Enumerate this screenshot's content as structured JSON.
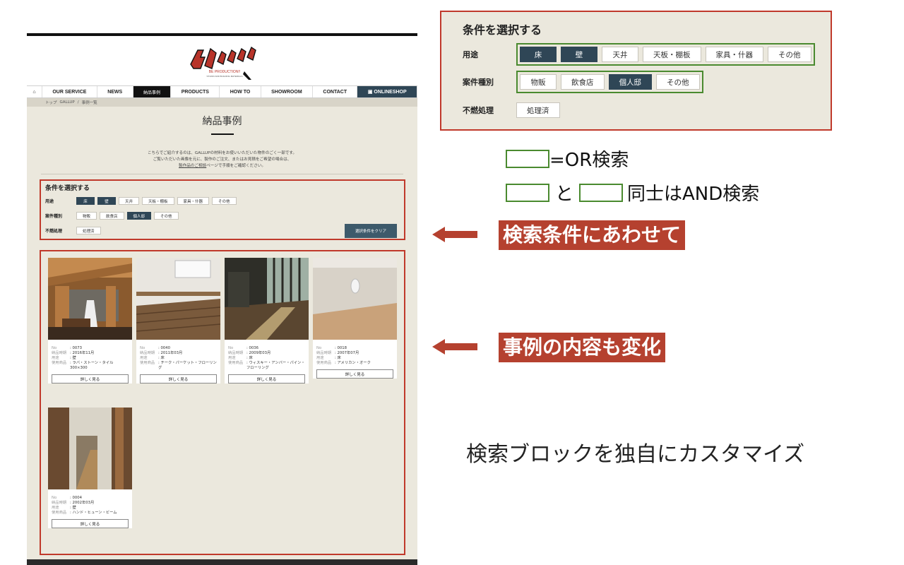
{
  "site": {
    "logo_text": "GALLUP",
    "logo_sub": "BE PRODUCTION!!",
    "logo_sub2": "STUDIO AND BUILDING MATERIALS",
    "nav": [
      "OUR SERVICE",
      "NEWS",
      "納品事例",
      "PRODUCTS",
      "HOW TO",
      "SHOWROOM",
      "CONTACT",
      "ONLINESHOP"
    ],
    "breadcrumb": [
      "トップ",
      "GALLUP",
      "/",
      "事例一覧"
    ],
    "page_title": "納品事例",
    "intro": [
      "こちらでご紹介するのは、GALLUPの材料をお使いいただいた物件のごく一部です。",
      "ご覧いただいた画像を元に、製作のご注文、またはお見積をご希望の場合は、",
      "ページで手順をご確認ください。"
    ],
    "intro_link": "製作品のご相談",
    "search": {
      "title": "条件を選択する",
      "rows": [
        {
          "label": "用途",
          "chips": [
            "床",
            "壁",
            "天井",
            "天板・棚板",
            "家具・什器",
            "その他"
          ],
          "selected": [
            0,
            1
          ]
        },
        {
          "label": "案件種別",
          "chips": [
            "物販",
            "飲食店",
            "個人邸",
            "その他"
          ],
          "selected": [
            2
          ]
        },
        {
          "label": "不燃処理",
          "chips": [
            "処理済"
          ],
          "selected": []
        }
      ],
      "clear_label": "選択条件をクリア"
    },
    "meta_keys": {
      "no": "No",
      "date": "納品時期",
      "use": "用途",
      "product": "使用商品"
    },
    "detail_label": "詳しく見る",
    "cards": [
      {
        "no": ": 0073",
        "date": ": 2016年11月",
        "use": ": 壁",
        "product": ": ラバ・ストーン・タイル 300×300"
      },
      {
        "no": ": 0040",
        "date": ": 2011年03月",
        "use": ": 床",
        "product": ": チーク・パーケット・フローリング"
      },
      {
        "no": ": 0036",
        "date": ": 2009年03月",
        "use": ": 床",
        "product": ": ウィスキー・アンバー・パイン・フローリング"
      },
      {
        "no": ": 0018",
        "date": ": 2007年07月",
        "use": ": 床",
        "product": ": アメリカン・オーク"
      },
      {
        "no": ": 0004",
        "date": ": 2002年03月",
        "use": ": 壁",
        "product": ": ハンド・ヒューン・ビーム"
      }
    ]
  },
  "zoom": {
    "title": "条件を選択する",
    "rows": [
      {
        "label": "用途",
        "chips": [
          "床",
          "壁",
          "天井",
          "天板・棚板",
          "家具・什器",
          "その他"
        ],
        "selected": [
          0,
          1
        ]
      },
      {
        "label": "案件種別",
        "chips": [
          "物販",
          "飲食店",
          "個人邸",
          "その他"
        ],
        "selected": [
          2
        ]
      },
      {
        "label": "不燃処理",
        "chips": [
          "処理済"
        ],
        "selected": []
      }
    ]
  },
  "legend": {
    "line1": "=OR検索",
    "line2_mid": "と",
    "line2_end": "同士はAND検索"
  },
  "callouts": {
    "search": "検索条件にあわせて",
    "results": "事例の内容も変化"
  },
  "caption": "検索ブロックを独自にカスタマイズ",
  "colors": {
    "accent_red": "#b5412f",
    "green": "#4a8a2f",
    "chip_selected": "#2f4656"
  }
}
